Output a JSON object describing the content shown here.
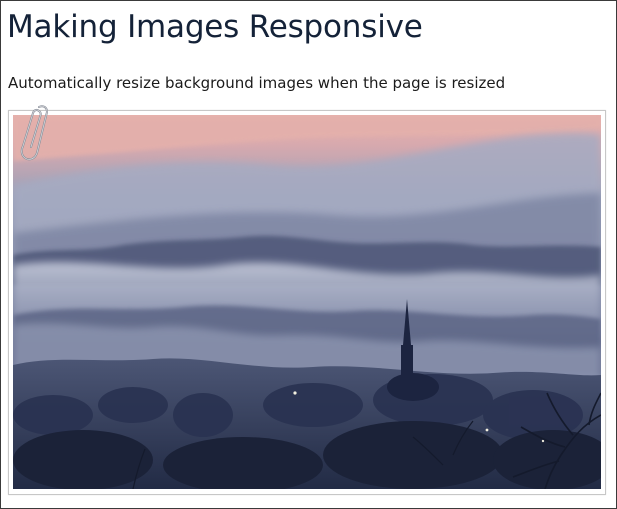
{
  "page": {
    "title": "Making Images Responsive",
    "subtitle": "Automatically resize background images when the page is resized"
  },
  "image": {
    "icon": "paperclip-icon",
    "palette": {
      "sky_top": "#e6b2ad",
      "sky_mid": "#9aa0b8",
      "fog": "#b5bbcf",
      "hills_far": "#6f7896",
      "hills_near": "#3c4566",
      "trees_dark": "#1f2841"
    }
  }
}
